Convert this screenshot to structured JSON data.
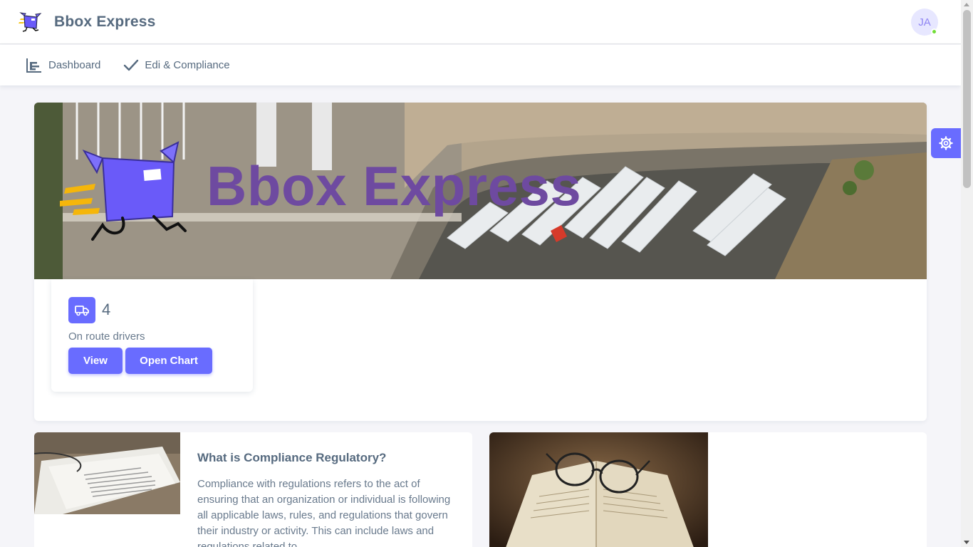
{
  "app": {
    "brand_name": "Bbox Express",
    "logo_icon": "box-mascot-logo-icon"
  },
  "user": {
    "initials": "JA",
    "status": "online",
    "status_color": "#71dd37"
  },
  "nav": {
    "items": [
      {
        "label": "Dashboard",
        "icon": "bar-chart-icon"
      },
      {
        "label": "Edi & Compliance",
        "icon": "check-icon"
      }
    ]
  },
  "settings": {
    "icon": "gear-icon"
  },
  "hero": {
    "title": "Bbox Express"
  },
  "stats": {
    "icon": "truck-icon",
    "value": "4",
    "label": "On route drivers",
    "view_label": "View",
    "chart_label": "Open Chart"
  },
  "compliance": {
    "title": "What is Compliance Regulatory?",
    "text": "Compliance with regulations refers to the act of ensuring that an organization or individual is following all applicable laws, rules, and regulations that govern their industry or activity. This can include laws and regulations related to"
  },
  "colors": {
    "primary": "#696cff",
    "hero_title": "#6e4aa0",
    "text": "#566a7f"
  }
}
